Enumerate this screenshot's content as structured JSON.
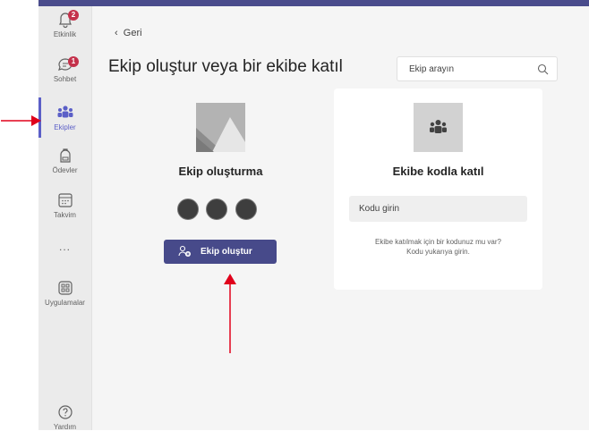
{
  "sidebar": {
    "items": [
      {
        "label": "Etkinlik",
        "badge": "2"
      },
      {
        "label": "Sohbet",
        "badge": "1"
      },
      {
        "label": "Ekipler"
      },
      {
        "label": "Ödevler"
      },
      {
        "label": "Takvim"
      },
      {
        "label": "..."
      },
      {
        "label": "Uygulamalar"
      },
      {
        "label": "Yardım"
      }
    ]
  },
  "header": {
    "back_label": "Geri",
    "title": "Ekip oluştur veya bir ekibe katıl",
    "search_placeholder": "Ekip arayın"
  },
  "create_card": {
    "title": "Ekip oluşturma",
    "button_label": "Ekip oluştur"
  },
  "join_card": {
    "title": "Ekibe kodla katıl",
    "code_placeholder": "Kodu girin",
    "hint_line1": "Ekibe katılmak için bir kodunuz mu var?",
    "hint_line2": "Kodu yukarıya girin."
  },
  "colors": {
    "accent": "#5b5fc7",
    "button": "#474a8a",
    "badge": "#c4314b",
    "annotation_arrow": "#e0001b"
  }
}
